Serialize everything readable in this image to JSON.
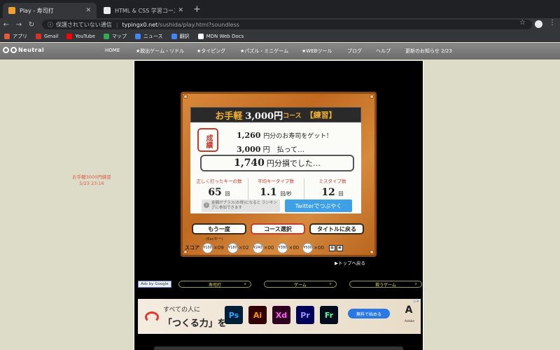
{
  "browser": {
    "tabs": [
      {
        "title": "Play - 寿司打",
        "close": "✕"
      },
      {
        "title": "HTML & CSS 学習コース 初級編",
        "close": "✕"
      }
    ],
    "new_tab": "+",
    "nav": {
      "back": "←",
      "forward": "→",
      "reload": "↻"
    },
    "address": {
      "info_icon": "ⓘ",
      "security_label": "保護されていない通信",
      "host": "typingx0.net",
      "path": "/sushida/play.html?soundless"
    },
    "bookmarks": [
      {
        "label": "アプリ",
        "color": "#e25a3a"
      },
      {
        "label": "Gmail",
        "color": "#d93025"
      },
      {
        "label": "YouTube",
        "color": "#ff0000"
      },
      {
        "label": "マップ",
        "color": "#34a853"
      },
      {
        "label": "ニュース",
        "color": "#4285f4"
      },
      {
        "label": "翻訳",
        "color": "#4285f4"
      },
      {
        "label": "MDN Web Docs",
        "color": "#ffffff"
      }
    ]
  },
  "site_nav": {
    "logo": "Neutral",
    "links": [
      "HOME",
      "★脱出ゲーム・リドル",
      "★タイピング",
      "★パズル・ミニゲーム",
      "★WEBツール",
      "ブログ",
      "ヘルプ"
    ],
    "updates": "更新のお知らせ 2/23"
  },
  "sidenote": {
    "line1": "お手軽3000円練習",
    "line2": "5/23 23:16"
  },
  "result": {
    "course_prefix": "お手軽",
    "course_amount": "3,000円",
    "course_suffix": "コース",
    "course_mode": "【練習】",
    "stamp": "成績",
    "earned_amount": "1,260",
    "earned_text": "円分のお寿司をゲット!",
    "paid_amount": "3,000",
    "paid_text": "円　払って…",
    "loss_amount": "1,740",
    "loss_text": "円分損でした…",
    "stats": [
      {
        "label": "正しく打ったキーの数",
        "value": "65",
        "unit": "回"
      },
      {
        "label": "平均キータイプ数",
        "value": "1.1",
        "unit": "回/秒"
      },
      {
        "label": "ミスタイプ数",
        "value": "12",
        "unit": "回"
      }
    ],
    "note_icon": "i",
    "note": "金額がプラス(お得)になると ランキングに参加できます",
    "tweet": "Twitterでつぶやく"
  },
  "buttons": {
    "retry": "もう一度",
    "retry_hint": "(Escキー)",
    "course_select": "コース選択",
    "back_title": "タイトルに戻る"
  },
  "score": {
    "label": "スコア",
    "plates": [
      {
        "price": "¥100",
        "count": "×09"
      },
      {
        "price": "¥180",
        "count": "×02"
      },
      {
        "price": "¥240",
        "count": "×00"
      },
      {
        "price": "¥380",
        "count": "×00"
      },
      {
        "price": "¥500",
        "count": "×00"
      }
    ]
  },
  "to_top": "▶トップへ戻る",
  "ads_row": {
    "ads_by": "Ads by Google",
    "search_boxes": [
      "寿司打",
      "ゲーム",
      "救うゲーム"
    ]
  },
  "banner": {
    "line1": "すべての人に",
    "line2": "「つくる力」を",
    "apps": [
      {
        "label": "Ps",
        "bg": "#001e36",
        "fg": "#31a8ff"
      },
      {
        "label": "Ai",
        "bg": "#330000",
        "fg": "#ff9a00"
      },
      {
        "label": "Xd",
        "bg": "#2e001f",
        "fg": "#ff61f6"
      },
      {
        "label": "Pr",
        "bg": "#00005b",
        "fg": "#9999ff"
      },
      {
        "label": "Fr",
        "bg": "#000b1d",
        "fg": "#51ff9b"
      }
    ],
    "cta": "無料で始める",
    "brand": "Adobe"
  },
  "colors": {
    "accent_red": "#c83a2e",
    "board_wood": "#c06a20",
    "tweet_blue": "#3ea0e6"
  }
}
